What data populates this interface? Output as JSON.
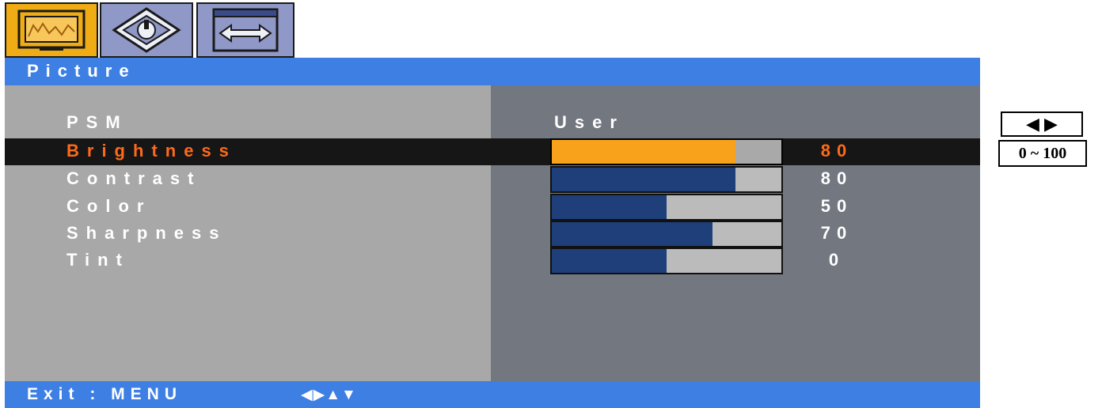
{
  "tabs": [
    {
      "icon": "picture-icon",
      "active": true
    },
    {
      "icon": "setup-icon",
      "active": false
    },
    {
      "icon": "screen-size-icon",
      "active": false
    }
  ],
  "title": "Picture",
  "psm": {
    "label": "PSM",
    "value": "User"
  },
  "settings": [
    {
      "label": "Brightness",
      "value": "80",
      "level": 80,
      "selected": true
    },
    {
      "label": "Contrast",
      "value": "80",
      "level": 80,
      "selected": false
    },
    {
      "label": "Color",
      "value": "50",
      "level": 50,
      "selected": false
    },
    {
      "label": "Sharpness",
      "value": "70",
      "level": 70,
      "selected": false
    },
    {
      "label": "Tint",
      "value": "0",
      "level": 50,
      "selected": false
    }
  ],
  "footer": {
    "exit": "Exit : MENU",
    "nav_symbols": "◀▶▲▼"
  },
  "callouts": {
    "arrows": "◀ ▶",
    "range": "0 ~ 100"
  },
  "colors": {
    "title_bar": "#3e7fe4",
    "selected_fill": "#f7a21a",
    "bar_fill": "#1e3f7a",
    "selected_text": "#ff6a1a"
  }
}
